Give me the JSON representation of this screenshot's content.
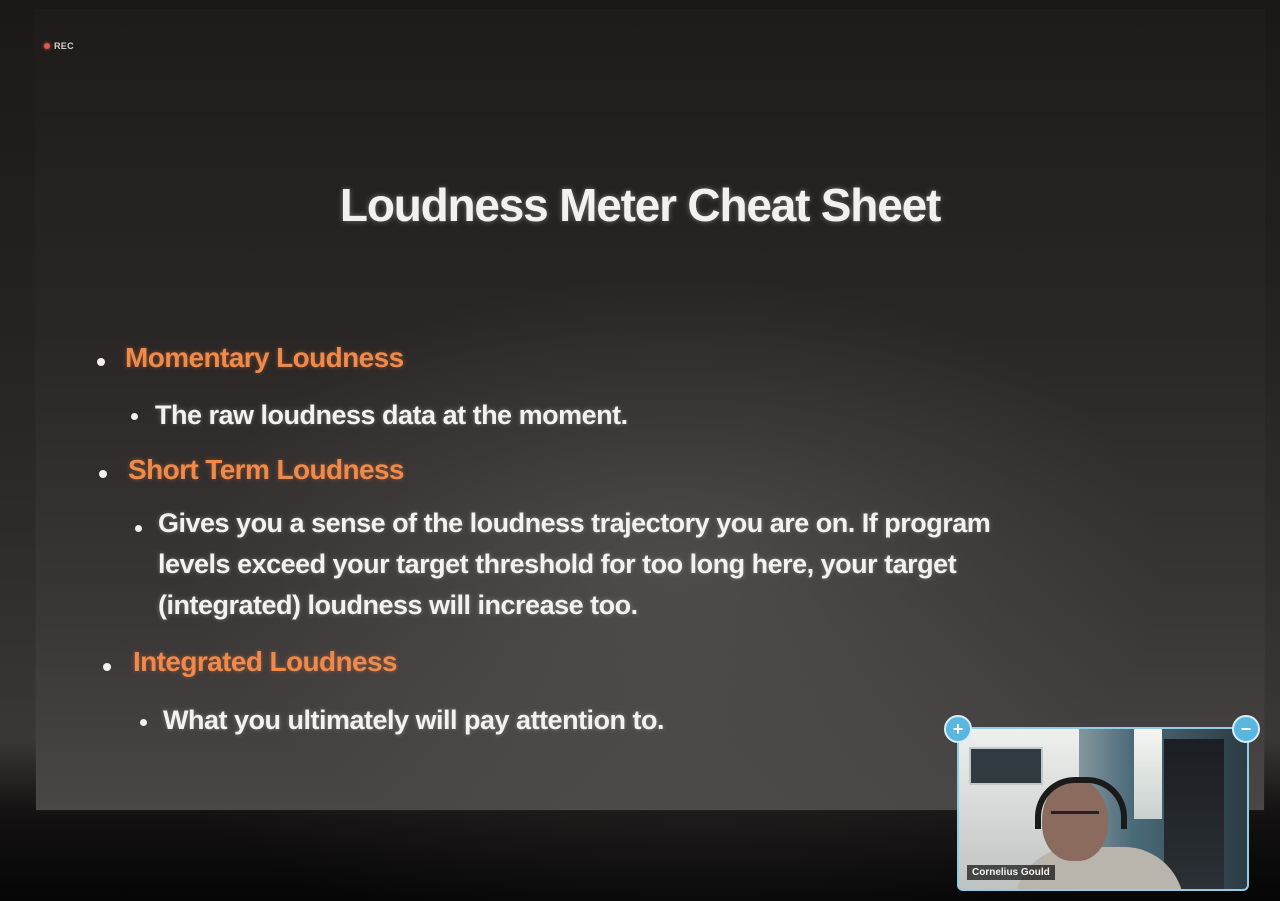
{
  "recording": {
    "label": "REC"
  },
  "slide": {
    "title": "Loudness Meter Cheat Sheet",
    "items": [
      {
        "heading": "Momentary Loudness",
        "detail": [
          "The raw loudness data at the moment."
        ]
      },
      {
        "heading": "Short Term Loudness",
        "detail": [
          "Gives you a sense of the loudness trajectory you are on.  If program",
          "levels exceed your target threshold for too long here, your target",
          "(integrated) loudness will increase too."
        ]
      },
      {
        "heading": "Integrated Loudness",
        "detail": [
          "What you ultimately will pay attention to."
        ]
      }
    ]
  },
  "video_tile": {
    "participant_name": "Cornelius Gould",
    "expand_icon": "+",
    "collapse_icon": "−"
  },
  "colors": {
    "heading_orange": "#f08a4a",
    "body_text": "#f4f2ef",
    "tile_accent": "#58b6e0"
  }
}
